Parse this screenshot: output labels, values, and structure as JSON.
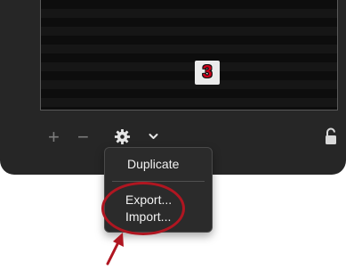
{
  "list": {
    "badge_text": "3"
  },
  "toolbar": {
    "add_glyph": "+",
    "remove_glyph": "−",
    "settings_icon": "gear-icon",
    "menu_chevron_icon": "chevron-down-icon",
    "lock_icon": "lock-icon"
  },
  "context_menu": {
    "duplicate_label": "Duplicate",
    "export_label": "Export...",
    "import_label": "Import..."
  },
  "annotation": {
    "highlight_color": "#b01621"
  },
  "colors": {
    "panel_bg": "#262626",
    "list_bg": "#0d0d0d",
    "menu_bg": "#2b2b2b",
    "badge_text": "#d0021b"
  }
}
